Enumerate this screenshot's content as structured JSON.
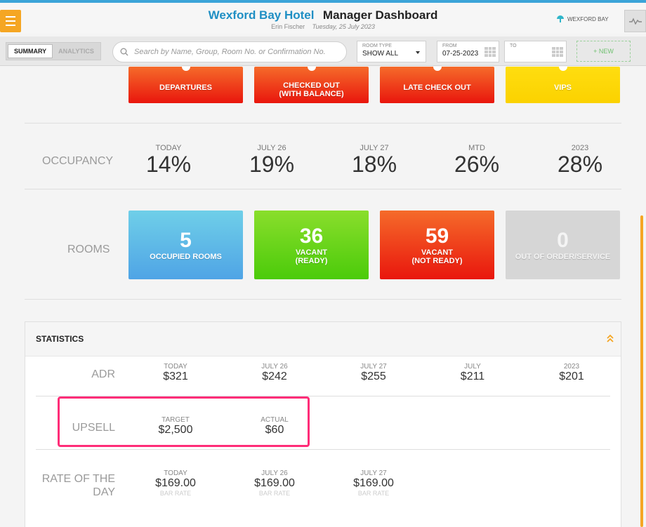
{
  "header": {
    "hotel_name": "Wexford Bay Hotel",
    "title": "Manager Dashboard",
    "user": "Erin Fischer",
    "date": "Tuesday, 25 July 2023",
    "brand": "WEXFORD BAY"
  },
  "toolbar": {
    "tabs": [
      {
        "label": "SUMMARY",
        "active": true
      },
      {
        "label": "ANALYTICS",
        "active": false
      }
    ],
    "search_placeholder": "Search by Name, Group, Room No. or Confirmation No.",
    "room_type_label": "ROOM TYPE",
    "room_type_value": "SHOW ALL",
    "from_label": "FROM",
    "from_value": "07-25-2023",
    "to_label": "TO",
    "to_value": "",
    "new_label": "+ NEW"
  },
  "top_tiles": [
    {
      "label": "DEPARTURES"
    },
    {
      "label": "CHECKED OUT\n(WITH BALANCE)"
    },
    {
      "label": "LATE CHECK OUT"
    },
    {
      "label": "VIPS"
    }
  ],
  "occupancy": {
    "label": "OCCUPANCY",
    "items": [
      {
        "label": "TODAY",
        "value": "14%"
      },
      {
        "label": "JULY 26",
        "value": "19%"
      },
      {
        "label": "JULY 27",
        "value": "18%"
      },
      {
        "label": "MTD",
        "value": "26%"
      },
      {
        "label": "2023",
        "value": "28%"
      }
    ]
  },
  "rooms": {
    "label": "ROOMS",
    "tiles": [
      {
        "value": "5",
        "label": "OCCUPIED ROOMS"
      },
      {
        "value": "36",
        "label": "VACANT\n(READY)"
      },
      {
        "value": "59",
        "label": "VACANT\n(NOT READY)"
      },
      {
        "value": "0",
        "label": "OUT OF ORDER/SERVICE"
      }
    ]
  },
  "statistics": {
    "title": "STATISTICS",
    "adr": {
      "label": "ADR",
      "items": [
        {
          "label": "TODAY",
          "value": "$321"
        },
        {
          "label": "JULY 26",
          "value": "$242"
        },
        {
          "label": "JULY 27",
          "value": "$255"
        },
        {
          "label": "JULY",
          "value": "$211"
        },
        {
          "label": "2023",
          "value": "$201"
        }
      ]
    },
    "upsell": {
      "label": "UPSELL",
      "items": [
        {
          "label": "TARGET",
          "value": "$2,500"
        },
        {
          "label": "ACTUAL",
          "value": "$60"
        }
      ]
    },
    "rate_of_the_day": {
      "label_line1": "RATE OF THE",
      "label_line2": "DAY",
      "items": [
        {
          "label": "TODAY",
          "value": "$169.00",
          "sub": "BAR RATE"
        },
        {
          "label": "JULY 26",
          "value": "$169.00",
          "sub": "BAR RATE"
        },
        {
          "label": "JULY 27",
          "value": "$169.00",
          "sub": "BAR RATE"
        }
      ]
    }
  }
}
